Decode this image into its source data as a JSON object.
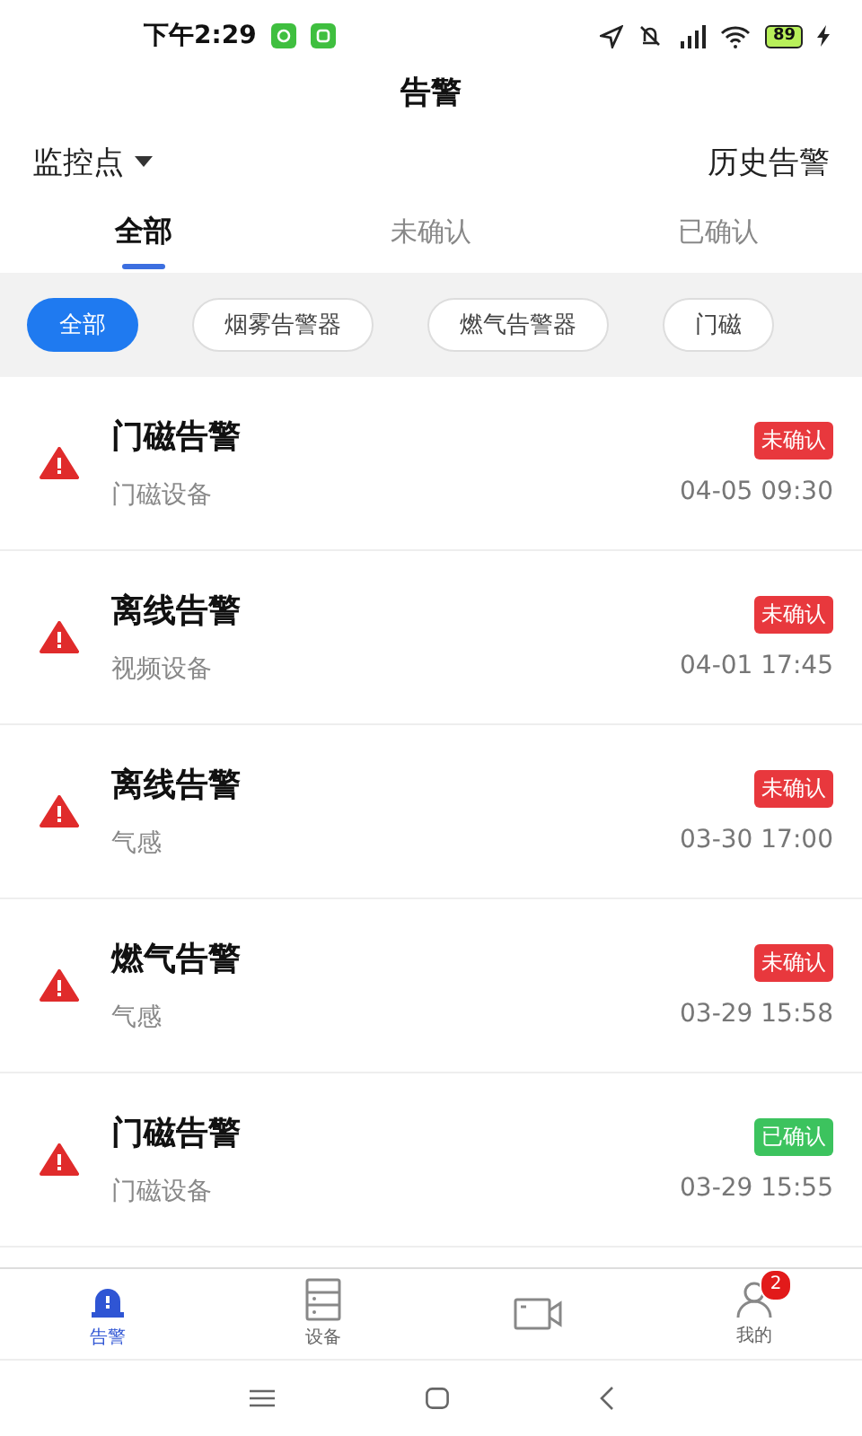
{
  "status_bar": {
    "time": "下午2:29",
    "battery": "89"
  },
  "header": {
    "title": "告警"
  },
  "toolbar": {
    "filter": "监控点",
    "history": "历史告警"
  },
  "tabs": [
    {
      "label": "全部",
      "selected": true
    },
    {
      "label": "未确认",
      "selected": false
    },
    {
      "label": "已确认",
      "selected": false
    }
  ],
  "chips": [
    {
      "label": "全部",
      "selected": true
    },
    {
      "label": "烟雾告警器",
      "selected": false
    },
    {
      "label": "燃气告警器",
      "selected": false
    },
    {
      "label": "门磁",
      "selected": false
    }
  ],
  "alarms": [
    {
      "title": "门磁告警",
      "device": "门磁设备",
      "status": "未确认",
      "confirmed": false,
      "time": "04-05 09:30"
    },
    {
      "title": "离线告警",
      "device": "视频设备",
      "status": "未确认",
      "confirmed": false,
      "time": "04-01 17:45"
    },
    {
      "title": "离线告警",
      "device": "气感",
      "status": "未确认",
      "confirmed": false,
      "time": "03-30 17:00"
    },
    {
      "title": "燃气告警",
      "device": "气感",
      "status": "未确认",
      "confirmed": false,
      "time": "03-29 15:58"
    },
    {
      "title": "门磁告警",
      "device": "门磁设备",
      "status": "已确认",
      "confirmed": true,
      "time": "03-29 15:55"
    }
  ],
  "bottom_nav": [
    {
      "kind": "alarm",
      "label": "告警",
      "selected": true
    },
    {
      "kind": "device",
      "label": "设备",
      "selected": false
    },
    {
      "kind": "video",
      "selected": false
    },
    {
      "kind": "user",
      "label": "我的",
      "selected": false,
      "badge": "2"
    }
  ]
}
